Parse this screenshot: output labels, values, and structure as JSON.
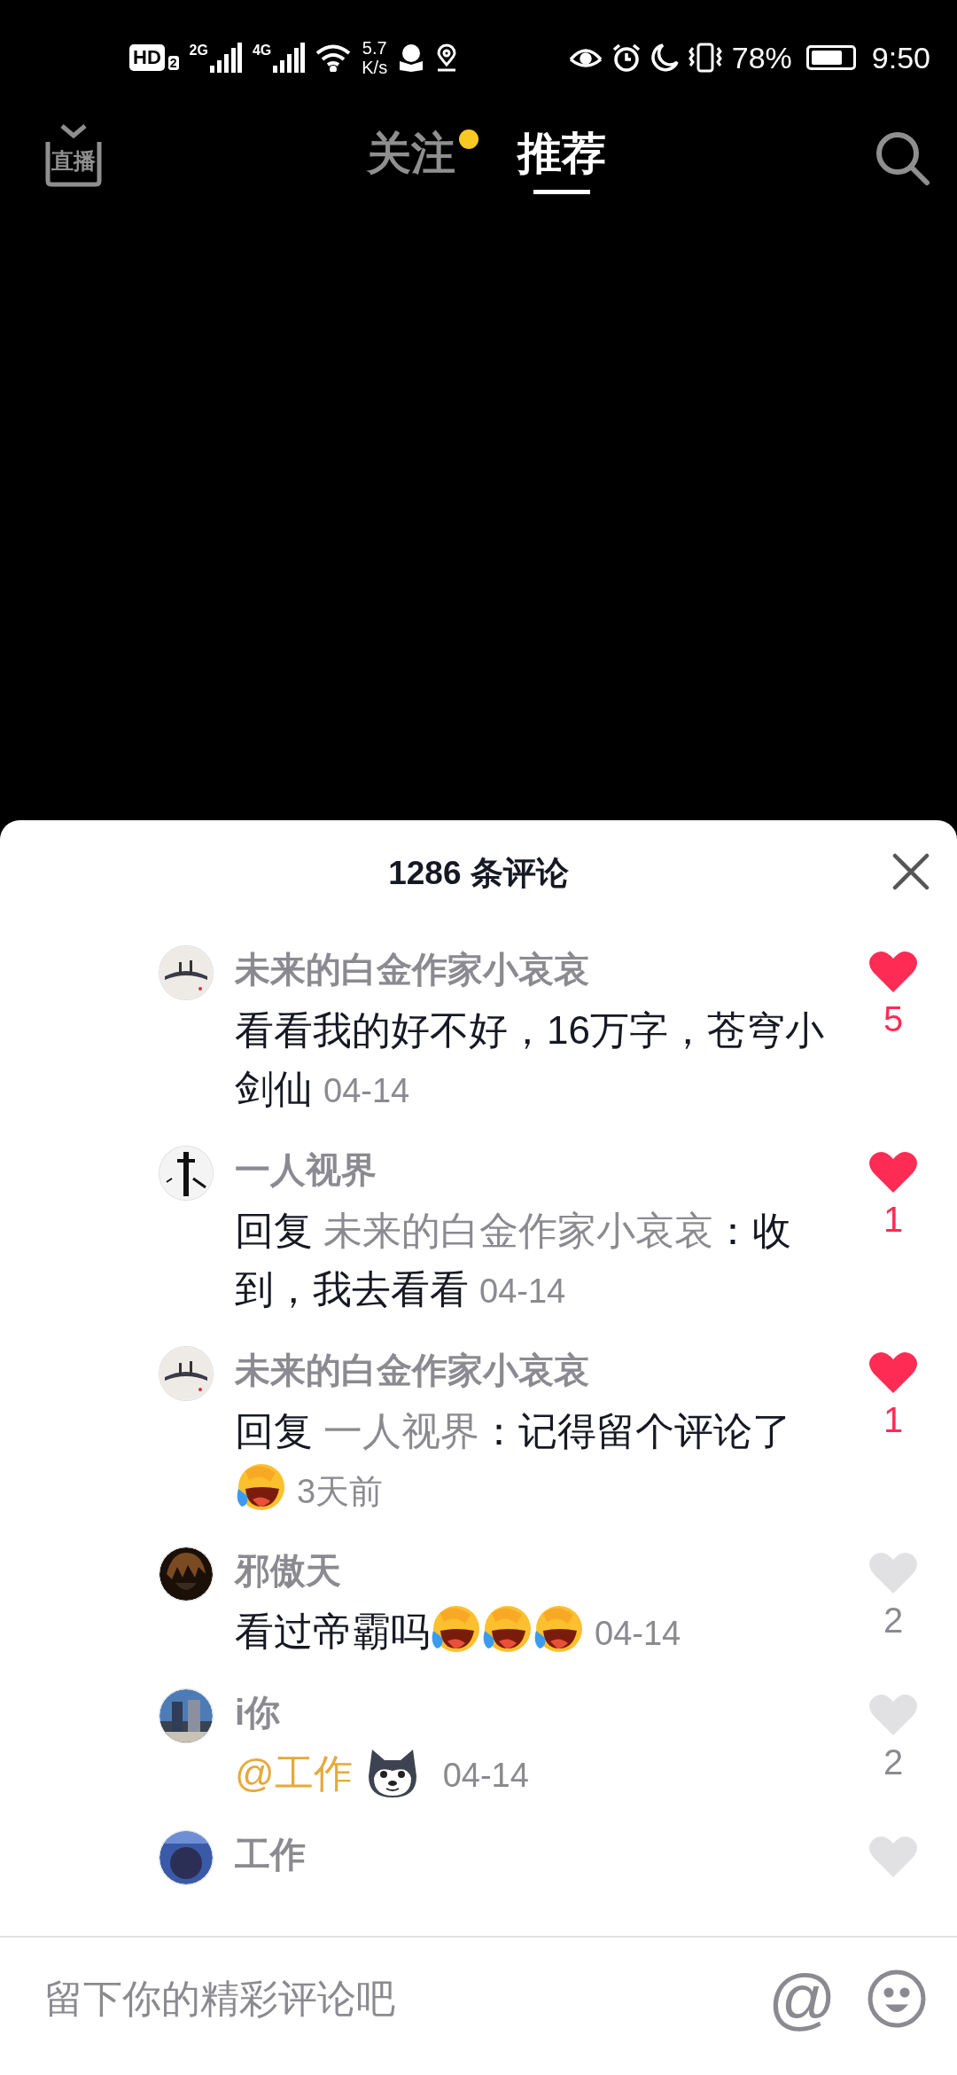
{
  "status_bar": {
    "hd": "HD",
    "hd_sim": "2",
    "sim1": "2G",
    "sim2": "4G",
    "speed_value": "5.7",
    "speed_unit": "K/s",
    "battery": "78%",
    "time": "9:50"
  },
  "top_nav": {
    "live_label": "直播",
    "tabs": [
      {
        "label": "关注",
        "selected": false,
        "dot": true
      },
      {
        "label": "推荐",
        "selected": true,
        "dot": false
      }
    ]
  },
  "comments_sheet": {
    "title": "1286 条评论",
    "comments": [
      {
        "user": "未来的白金作家小哀哀",
        "liked": true,
        "likes": "5",
        "time": "04-14",
        "body": [
          {
            "kind": "text",
            "text": "看看我的好不好，16万字，苍穹小剑仙"
          }
        ]
      },
      {
        "user": "一人视界",
        "liked": true,
        "likes": "1",
        "time": "04-14",
        "body": [
          {
            "kind": "text",
            "text": "回复 "
          },
          {
            "kind": "user",
            "text": "未来的白金作家小哀哀"
          },
          {
            "kind": "text",
            "text": "：收到，我去看看"
          }
        ]
      },
      {
        "user": "未来的白金作家小哀哀",
        "liked": true,
        "likes": "1",
        "time": "3天前",
        "body": [
          {
            "kind": "text",
            "text": "回复 "
          },
          {
            "kind": "user",
            "text": "一人视界"
          },
          {
            "kind": "text",
            "text": "：记得留个评论了"
          },
          {
            "kind": "emoji"
          }
        ]
      },
      {
        "user": "邪傲天",
        "liked": false,
        "likes": "2",
        "time": "04-14",
        "body": [
          {
            "kind": "text",
            "text": "看过帝霸吗"
          },
          {
            "kind": "emoji"
          },
          {
            "kind": "emoji"
          },
          {
            "kind": "emoji"
          }
        ]
      },
      {
        "user": "i你",
        "liked": false,
        "likes": "2",
        "time": "04-14",
        "body": [
          {
            "kind": "mention",
            "text": "@工作"
          },
          {
            "kind": "sticker"
          }
        ]
      },
      {
        "user": "工作",
        "liked": false
      }
    ]
  },
  "input_bar": {
    "placeholder": "留下你的精彩评论吧",
    "at_button": "@"
  }
}
